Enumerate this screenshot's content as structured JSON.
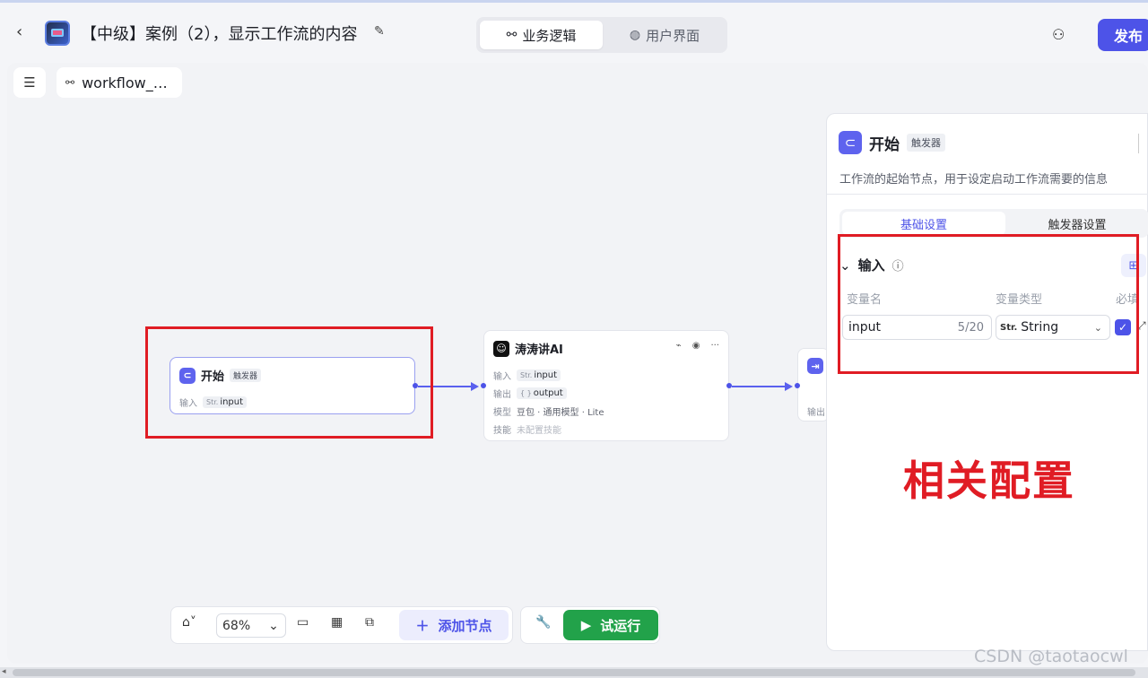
{
  "header": {
    "title": "【中级】案例（2），显示工作流的内容",
    "tabs": [
      {
        "label": "业务逻辑",
        "icon": "workflow-icon",
        "active": true
      },
      {
        "label": "用户界面",
        "icon": "palette-icon",
        "active": false
      }
    ],
    "publish_label": "发布"
  },
  "canvas_top": {
    "workflow_name": "workflow_…"
  },
  "nodes": {
    "start": {
      "title": "开始",
      "tag": "触发器",
      "input_label": "输入",
      "input_type": "Str.",
      "input_value": "input"
    },
    "ai": {
      "title": "涛涛讲AI",
      "rows": [
        {
          "label": "输入",
          "type": "Str.",
          "value": "input"
        },
        {
          "label": "输出",
          "type": "{ }",
          "value": "output"
        },
        {
          "label": "模型",
          "value": "豆包 · 通用模型 · Lite"
        },
        {
          "label": "技能",
          "value": "未配置技能"
        }
      ]
    },
    "end": {
      "row_label": "输出"
    }
  },
  "toolbar": {
    "zoom": "68%",
    "add_node_label": "添加节点",
    "run_label": "试运行"
  },
  "panel": {
    "title": "开始",
    "tag": "触发器",
    "description": "工作流的起始节点，用于设定启动工作流需要的信息",
    "tabs": [
      {
        "label": "基础设置",
        "active": true
      },
      {
        "label": "触发器设置",
        "active": false
      }
    ],
    "section_title": "输入",
    "columns": [
      "变量名",
      "变量类型",
      "必填"
    ],
    "variable": {
      "name": "input",
      "count": "5/20",
      "type_prefix": "Str.",
      "type": "String",
      "required": true
    }
  },
  "annotation": "相关配置",
  "watermark": "CSDN @taotaocwl",
  "colors": {
    "accent": "#4d53e8",
    "run": "#22a24a",
    "annotation_red": "#e01c24"
  }
}
